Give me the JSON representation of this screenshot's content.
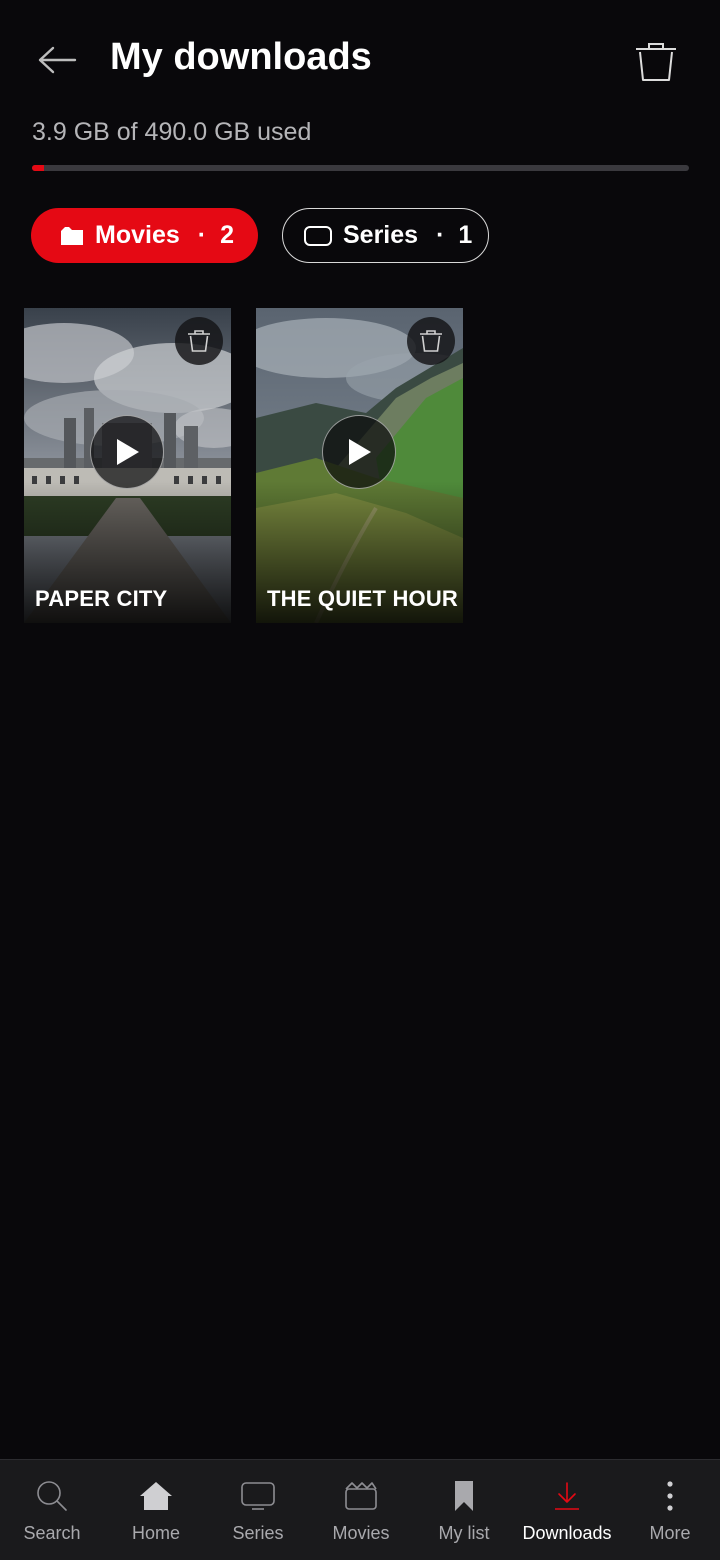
{
  "header": {
    "title": "My downloads"
  },
  "storage": {
    "text": "3.9 GB of 490.0 GB used",
    "used_fraction": 0.008,
    "fill_color": "#e50914"
  },
  "filters": [
    {
      "label": "Movies",
      "separator": "·",
      "count": "2",
      "active": true,
      "icon": "folder-icon"
    },
    {
      "label": "Series",
      "separator": "·",
      "count": "1",
      "active": false,
      "icon": "tv-icon"
    }
  ],
  "downloads": [
    {
      "title": "PAPER CITY",
      "thumbnail": "chateau-under-clouds"
    },
    {
      "title": "THE QUIET HOUR",
      "thumbnail": "green-mountain-valley"
    }
  ],
  "bottom_nav": {
    "items": [
      {
        "label": "Search",
        "icon": "search-icon"
      },
      {
        "label": "Home",
        "icon": "home-icon"
      },
      {
        "label": "Series",
        "icon": "tv-icon"
      },
      {
        "label": "Movies",
        "icon": "clapper-icon"
      },
      {
        "label": "My list",
        "icon": "bookmark-icon"
      },
      {
        "label": "Downloads",
        "icon": "download-icon",
        "active": true
      },
      {
        "label": "More",
        "icon": "more-vertical-icon"
      }
    ]
  },
  "colors": {
    "background": "#09080b",
    "accent": "#e50914",
    "nav_background": "#1a1a1c"
  }
}
